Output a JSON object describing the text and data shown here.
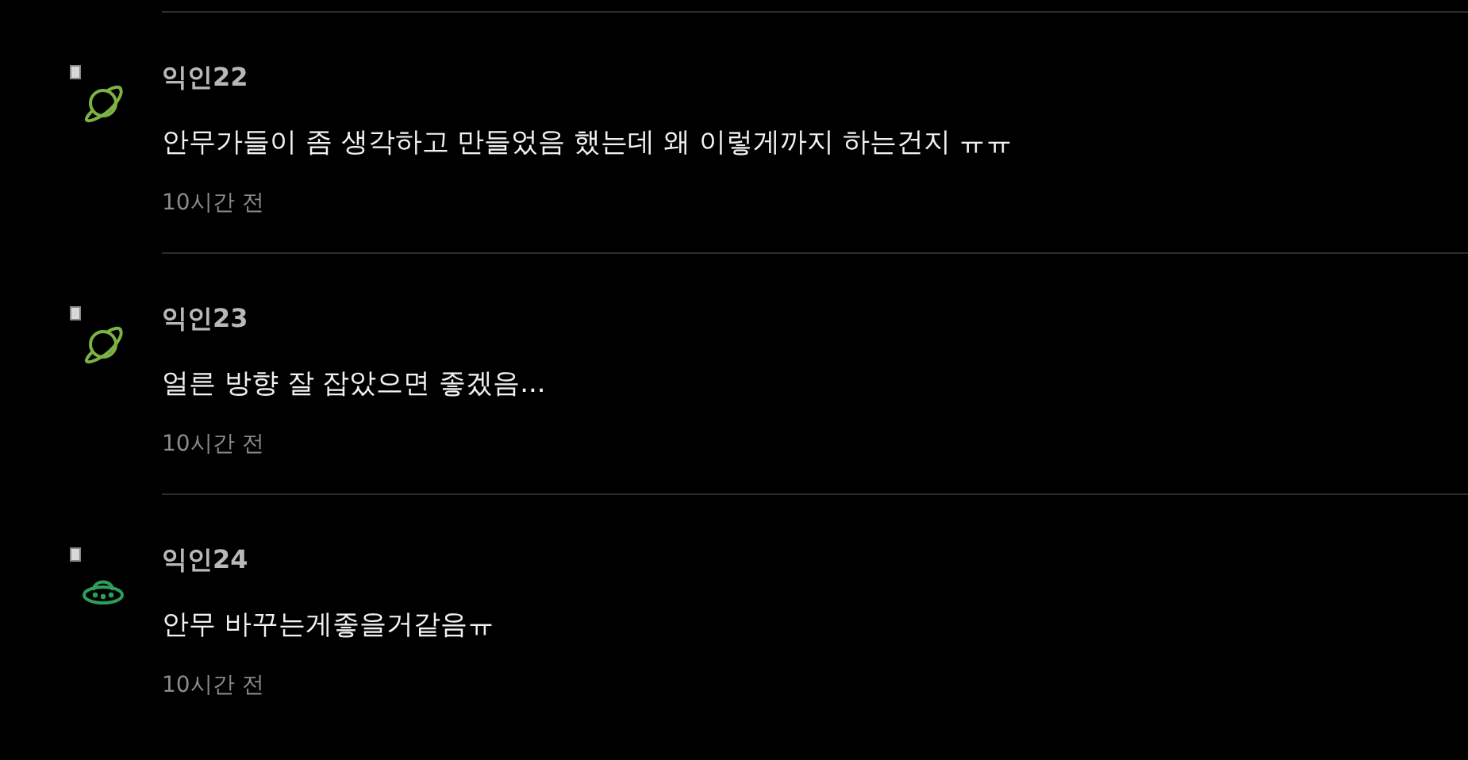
{
  "comments": [
    {
      "author": "익인22",
      "avatar": {
        "kind": "planet",
        "color": "#7cb342"
      },
      "text": "안무가들이 좀 생각하고 만들었음 했는데 왜 이렇게까지 하는건지 ㅠㅠ",
      "time": "10시간 전"
    },
    {
      "author": "익인23",
      "avatar": {
        "kind": "planet",
        "color": "#7cb342"
      },
      "text": "얼른 방향 잘 잡았으면 좋겠음...",
      "time": "10시간 전"
    },
    {
      "author": "익인24",
      "avatar": {
        "kind": "ufo",
        "color": "#2e9e5b"
      },
      "text": "안무 바꾸는게좋을거같음ㅠ",
      "time": "10시간 전"
    }
  ]
}
